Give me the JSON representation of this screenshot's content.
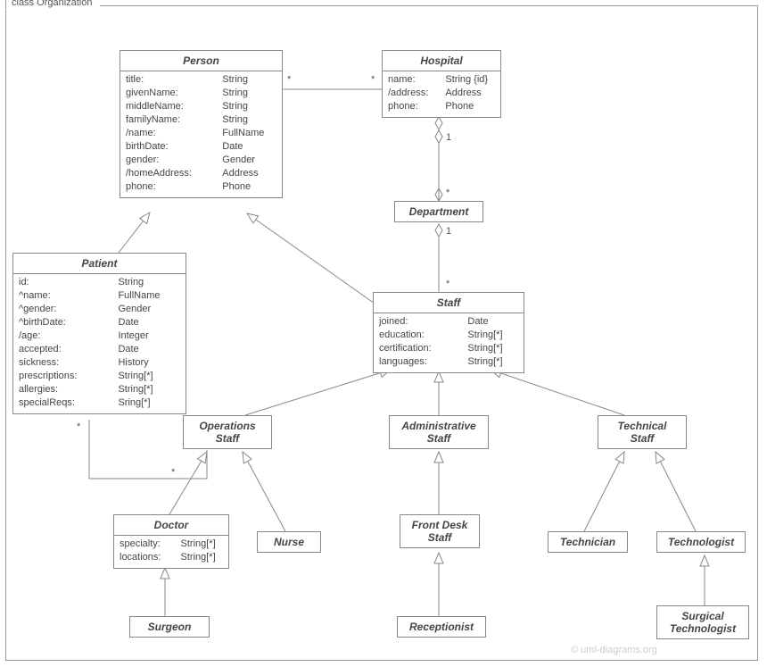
{
  "frame_title": "class Organization",
  "watermark": "© uml-diagrams.org",
  "classes": {
    "person": {
      "name": "Person",
      "attrs": [
        [
          "title:",
          "String"
        ],
        [
          "givenName:",
          "String"
        ],
        [
          "middleName:",
          "String"
        ],
        [
          "familyName:",
          "String"
        ],
        [
          "/name:",
          "FullName"
        ],
        [
          "birthDate:",
          "Date"
        ],
        [
          "gender:",
          "Gender"
        ],
        [
          "/homeAddress:",
          "Address"
        ],
        [
          "phone:",
          "Phone"
        ]
      ]
    },
    "hospital": {
      "name": "Hospital",
      "attrs": [
        [
          "name:",
          "String {id}"
        ],
        [
          "/address:",
          "Address"
        ],
        [
          "phone:",
          "Phone"
        ]
      ]
    },
    "department": {
      "name": "Department"
    },
    "patient": {
      "name": "Patient",
      "attrs": [
        [
          "id:",
          "String"
        ],
        [
          "^name:",
          "FullName"
        ],
        [
          "^gender:",
          "Gender"
        ],
        [
          "^birthDate:",
          "Date"
        ],
        [
          "/age:",
          "Integer"
        ],
        [
          "accepted:",
          "Date"
        ],
        [
          "sickness:",
          "History"
        ],
        [
          "prescriptions:",
          "String[*]"
        ],
        [
          "allergies:",
          "String[*]"
        ],
        [
          "specialReqs:",
          "Sring[*]"
        ]
      ]
    },
    "staff": {
      "name": "Staff",
      "attrs": [
        [
          "joined:",
          "Date"
        ],
        [
          "education:",
          "String[*]"
        ],
        [
          "certification:",
          "String[*]"
        ],
        [
          "languages:",
          "String[*]"
        ]
      ]
    },
    "opsStaff": {
      "name": "Operations",
      "sub": "Staff"
    },
    "adminStaff": {
      "name": "Administrative",
      "sub": "Staff"
    },
    "techStaff": {
      "name": "Technical",
      "sub": "Staff"
    },
    "doctor": {
      "name": "Doctor",
      "attrs": [
        [
          "specialty:",
          "String[*]"
        ],
        [
          "locations:",
          "String[*]"
        ]
      ]
    },
    "nurse": {
      "name": "Nurse"
    },
    "frontDesk": {
      "name": "Front Desk",
      "sub": "Staff"
    },
    "technician": {
      "name": "Technician"
    },
    "technologist": {
      "name": "Technologist"
    },
    "surgeon": {
      "name": "Surgeon"
    },
    "receptionist": {
      "name": "Receptionist"
    },
    "surgTech": {
      "name": "Surgical",
      "sub": "Technologist"
    }
  },
  "multiplicities": {
    "person_hosp_l": "*",
    "person_hosp_r": "*",
    "hosp_dept_t": "1",
    "hosp_dept_b": "*",
    "dept_staff_t": "1",
    "dept_staff_b": "*",
    "patient_ops_l": "*",
    "patient_ops_r": "*"
  }
}
